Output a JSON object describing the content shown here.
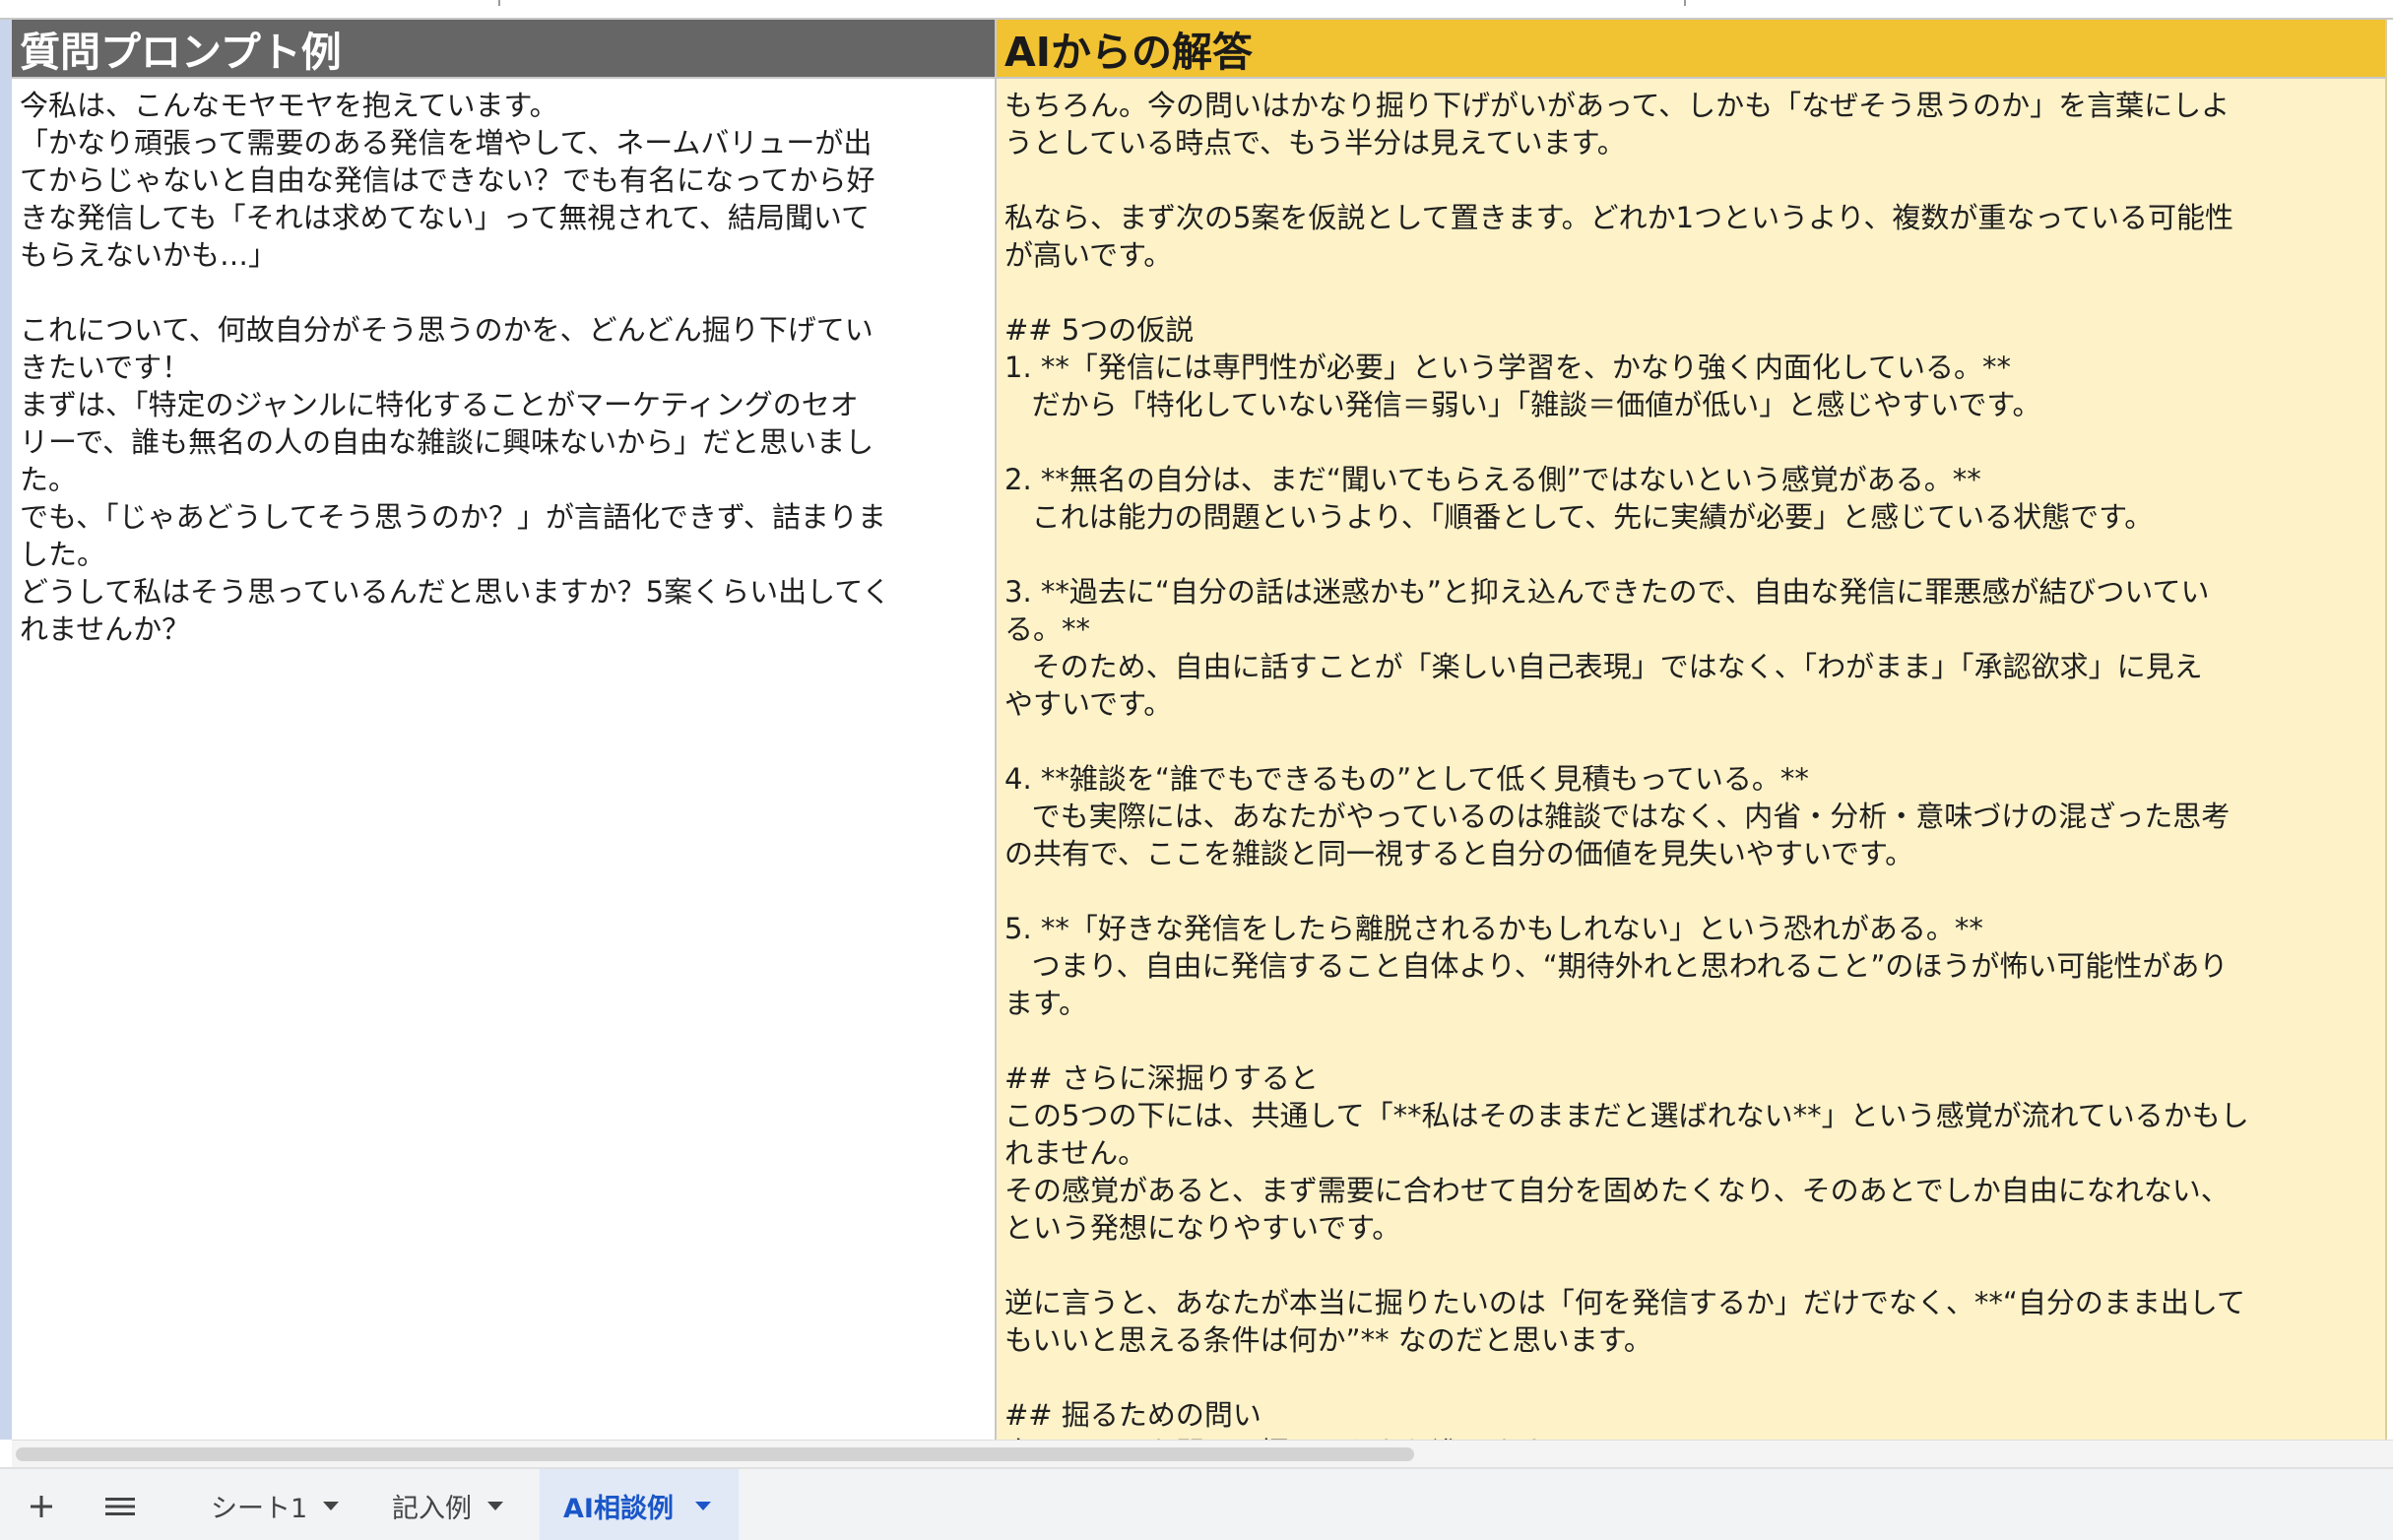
{
  "sheet": {
    "question_header": "質問プロンプト例",
    "answer_header": "AIからの解答",
    "question_lines": [
      "今私は、こんなモヤモヤを抱えています。",
      "「かなり頑張って需要のある発信を増やして、ネームバリューが出",
      "てからじゃないと自由な発信はできない？でも有名になってから好",
      "きな発信しても「それは求めてない」って無視されて、結局聞いて",
      "もらえないかも…」",
      "",
      "これについて、何故自分がそう思うのかを、どんどん掘り下げてい",
      "きたいです！",
      "まずは、「特定のジャンルに特化することがマーケティングのセオ",
      "リーで、誰も無名の人の自由な雑談に興味ないから」だと思いまし",
      "た。",
      "でも、「じゃあどうしてそう思うのか？」が言語化できず、詰まりま",
      "した。",
      "どうして私はそう思っているんだと思いますか？5案くらい出してく",
      "れませんか？"
    ],
    "answer_lines": [
      "もちろん。今の問いはかなり掘り下げがいがあって、しかも「なぜそう思うのか」を言葉にしよ",
      "うとしている時点で、もう半分は見えています。",
      "",
      "私なら、まず次の5案を仮説として置きます。どれか1つというより、複数が重なっている可能性",
      "が高いです。",
      "",
      "## 5つの仮説",
      "1. **「発信には専門性が必要」という学習を、かなり強く内面化している。**",
      "   だから「特化していない発信＝弱い」「雑談＝価値が低い」と感じやすいです。",
      "",
      "2. **無名の自分は、まだ“聞いてもらえる側”ではないという感覚がある。**",
      "   これは能力の問題というより、「順番として、先に実績が必要」と感じている状態です。",
      "",
      "3. **過去に“自分の話は迷惑かも”と抑え込んできたので、自由な発信に罪悪感が結びついてい",
      "る。**",
      "   そのため、自由に話すことが「楽しい自己表現」ではなく、「わがまま」「承認欲求」に見え",
      "やすいです。",
      "",
      "4. **雑談を“誰でもできるもの”として低く見積もっている。**",
      "   でも実際には、あなたがやっているのは雑談ではなく、内省・分析・意味づけの混ざった思考",
      "の共有で、ここを雑談と同一視すると自分の価値を見失いやすいです。",
      "",
      "5. **「好きな発信をしたら離脱されるかもしれない」という恐れがある。**",
      "   つまり、自由に発信すること自体より、“期待外れと思われること”のほうが怖い可能性があり",
      "ます。",
      "",
      "## さらに深掘りすると",
      "この5つの下には、共通して「**私はそのままだと選ばれない**」という感覚が流れているかもし",
      "れません。",
      "その感覚があると、まず需要に合わせて自分を固めたくなり、そのあとでしか自由になれない、",
      "という発想になりやすいです。",
      "",
      "逆に言うと、あなたが本当に掘りたいのは「何を発信するか」だけでなく、**“自分のまま出して",
      "もいいと思える条件は何か”** なのだと思います。",
      "",
      "## 掘るための問い",
      "次は、こんな問いで掘るとかなり進みます。"
    ]
  },
  "tabs": {
    "add_icon": "plus-icon",
    "menu_icon": "hamburger-icon",
    "items": [
      {
        "label": "シート1",
        "active": false
      },
      {
        "label": "記入例",
        "active": false
      },
      {
        "label": "AI相談例",
        "active": true
      }
    ]
  },
  "colors": {
    "question_header_bg": "#666666",
    "answer_header_bg": "#f1c232",
    "answer_body_bg": "#fdf2c8",
    "active_tab_text": "#1a56c8"
  }
}
